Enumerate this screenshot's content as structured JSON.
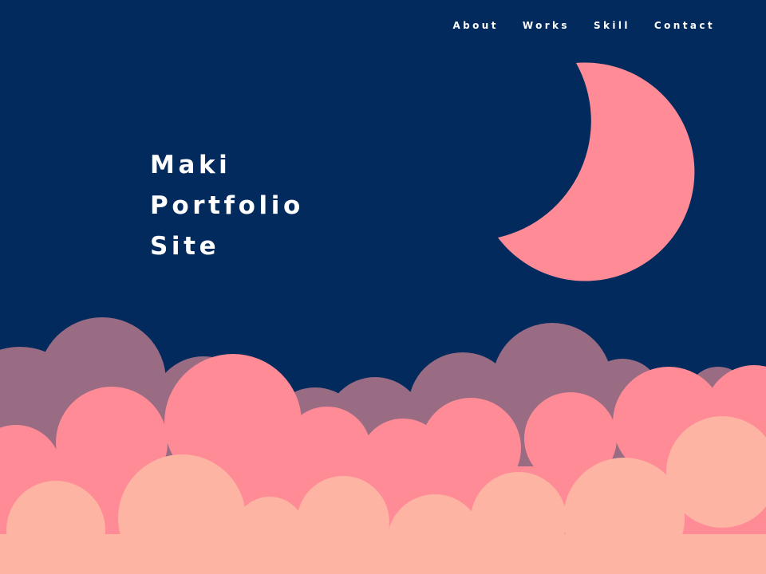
{
  "nav": {
    "items": [
      {
        "label": "About"
      },
      {
        "label": "Works"
      },
      {
        "label": "Skill"
      },
      {
        "label": "Contact"
      }
    ]
  },
  "hero": {
    "title_lines": [
      "Maki",
      "Portfolio",
      "Site"
    ]
  },
  "colors": {
    "background": "#022a5c",
    "moon": "#fe8b96",
    "cloud_back": "#9a6c84",
    "cloud_middle": "#fe8b96",
    "cloud_front": "#fdb4a2",
    "text": "#ffffff"
  }
}
